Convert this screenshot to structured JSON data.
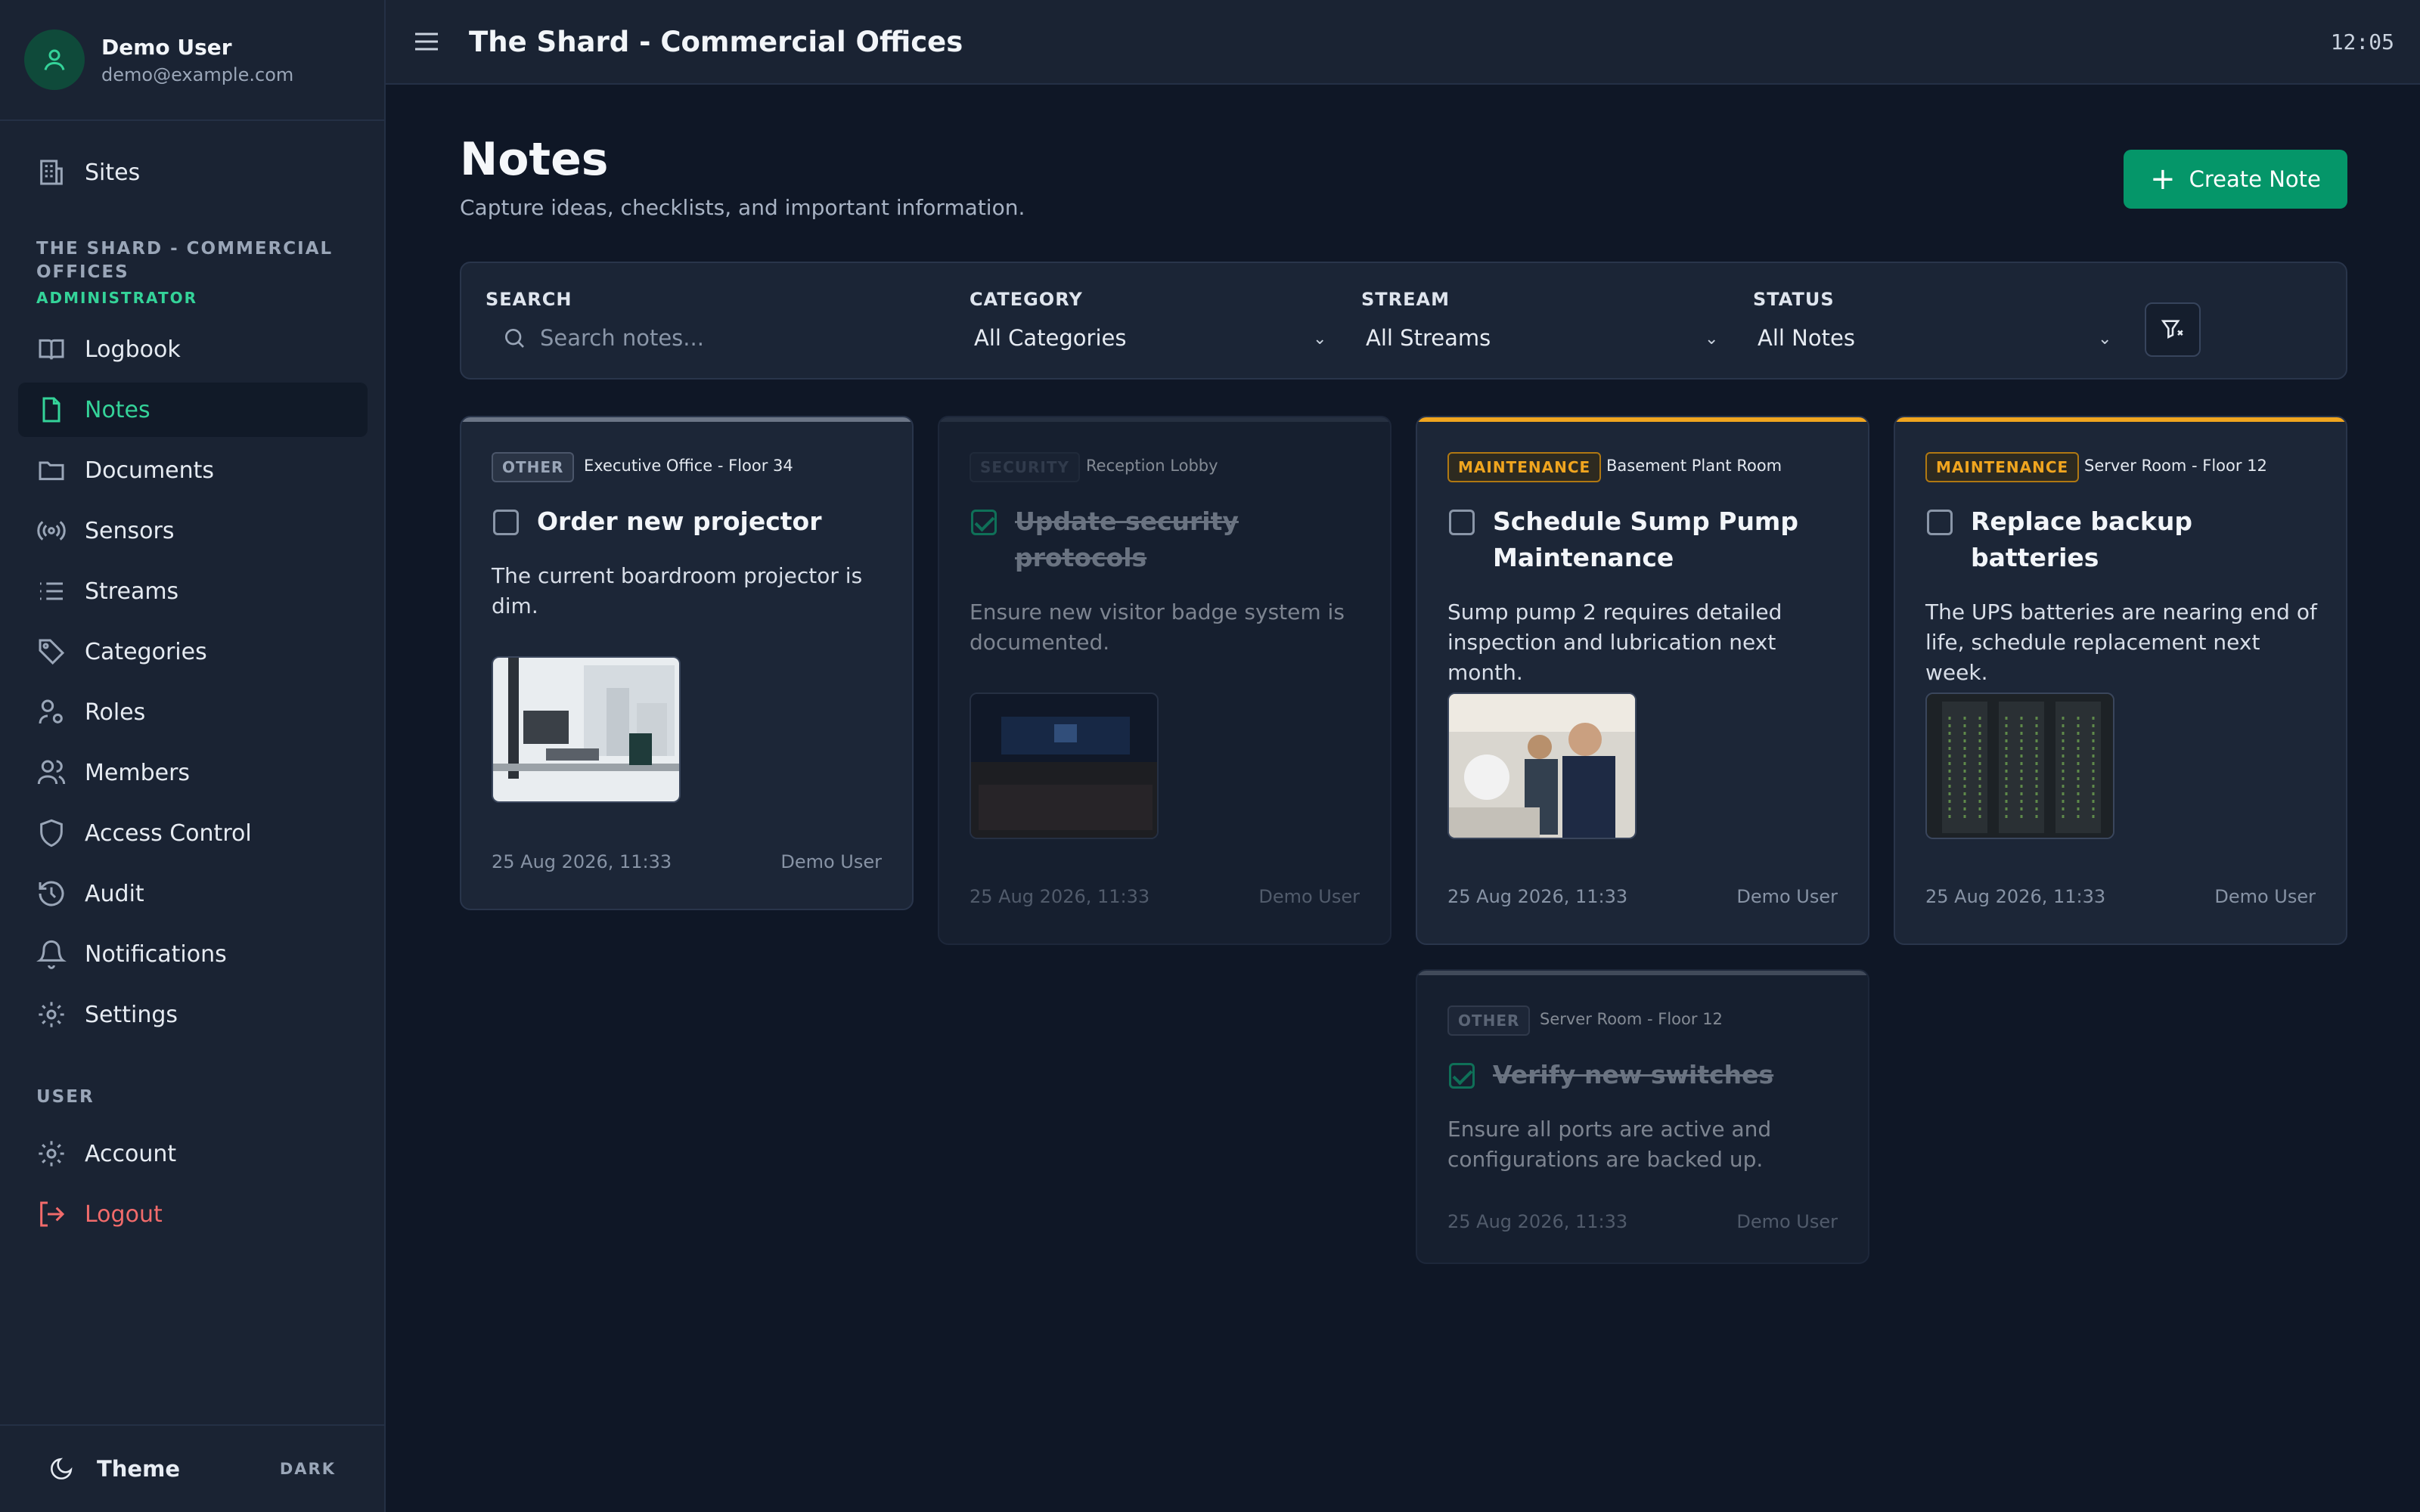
{
  "user": {
    "name": "Demo User",
    "email": "demo@example.com"
  },
  "sidebar": {
    "sites": "Sites",
    "site_section": "THE SHARD - COMMERCIAL OFFICES",
    "role": "ADMINISTRATOR",
    "items": [
      {
        "label": "Logbook",
        "icon": "book-icon"
      },
      {
        "label": "Notes",
        "icon": "file-icon"
      },
      {
        "label": "Documents",
        "icon": "folder-icon"
      },
      {
        "label": "Sensors",
        "icon": "broadcast-icon"
      },
      {
        "label": "Streams",
        "icon": "list-icon"
      },
      {
        "label": "Categories",
        "icon": "tag-icon"
      },
      {
        "label": "Roles",
        "icon": "user-cog-icon"
      },
      {
        "label": "Members",
        "icon": "users-icon"
      },
      {
        "label": "Access Control",
        "icon": "shield-icon"
      },
      {
        "label": "Audit",
        "icon": "history-icon"
      },
      {
        "label": "Notifications",
        "icon": "bell-icon"
      },
      {
        "label": "Settings",
        "icon": "gear-icon"
      }
    ],
    "user_section": "USER",
    "account": "Account",
    "logout": "Logout",
    "theme_label": "Theme",
    "theme_value": "DARK"
  },
  "topbar": {
    "title": "The Shard - Commercial Offices",
    "clock": "12:05"
  },
  "page": {
    "title": "Notes",
    "subtitle": "Capture ideas, checklists, and important information.",
    "create_label": "Create Note"
  },
  "filters": {
    "search_label": "SEARCH",
    "search_placeholder": "Search notes...",
    "category_label": "CATEGORY",
    "category_value": "All Categories",
    "stream_label": "STREAM",
    "stream_value": "All Streams",
    "status_label": "STATUS",
    "status_value": "All Notes"
  },
  "notes": [
    {
      "category": "OTHER",
      "location": "Executive Office - Floor 34",
      "title": "Order new projector",
      "body": "The current boardroom projector is dim.",
      "date": "25 Aug 2026, 11:33",
      "author": "Demo User",
      "done": false
    },
    {
      "category": "SECURITY",
      "location": "Reception Lobby",
      "title": "Update security protocols",
      "body": "Ensure new visitor badge system is documented.",
      "date": "25 Aug 2026, 11:33",
      "author": "Demo User",
      "done": true
    },
    {
      "category": "MAINTENANCE",
      "location": "Basement Plant Room",
      "title": "Schedule Sump Pump Maintenance",
      "body": "Sump pump 2 requires detailed inspection and lubrication next month.",
      "date": "25 Aug 2026, 11:33",
      "author": "Demo User",
      "done": false
    },
    {
      "category": "MAINTENANCE",
      "location": "Server Room - Floor 12",
      "title": "Replace backup batteries",
      "body": "The UPS batteries are nearing end of life, schedule replacement next week.",
      "date": "25 Aug 2026, 11:33",
      "author": "Demo User",
      "done": false
    },
    {
      "category": "OTHER",
      "location": "Server Room - Floor 12",
      "title": "Verify new switches",
      "body": "Ensure all ports are active and configurations are backed up.",
      "date": "25 Aug 2026, 11:33",
      "author": "Demo User",
      "done": true
    }
  ],
  "colors": {
    "accent": "#059669",
    "active_nav": "#34d399",
    "maintenance": "#f0a51f",
    "logout": "#f26b6b"
  }
}
